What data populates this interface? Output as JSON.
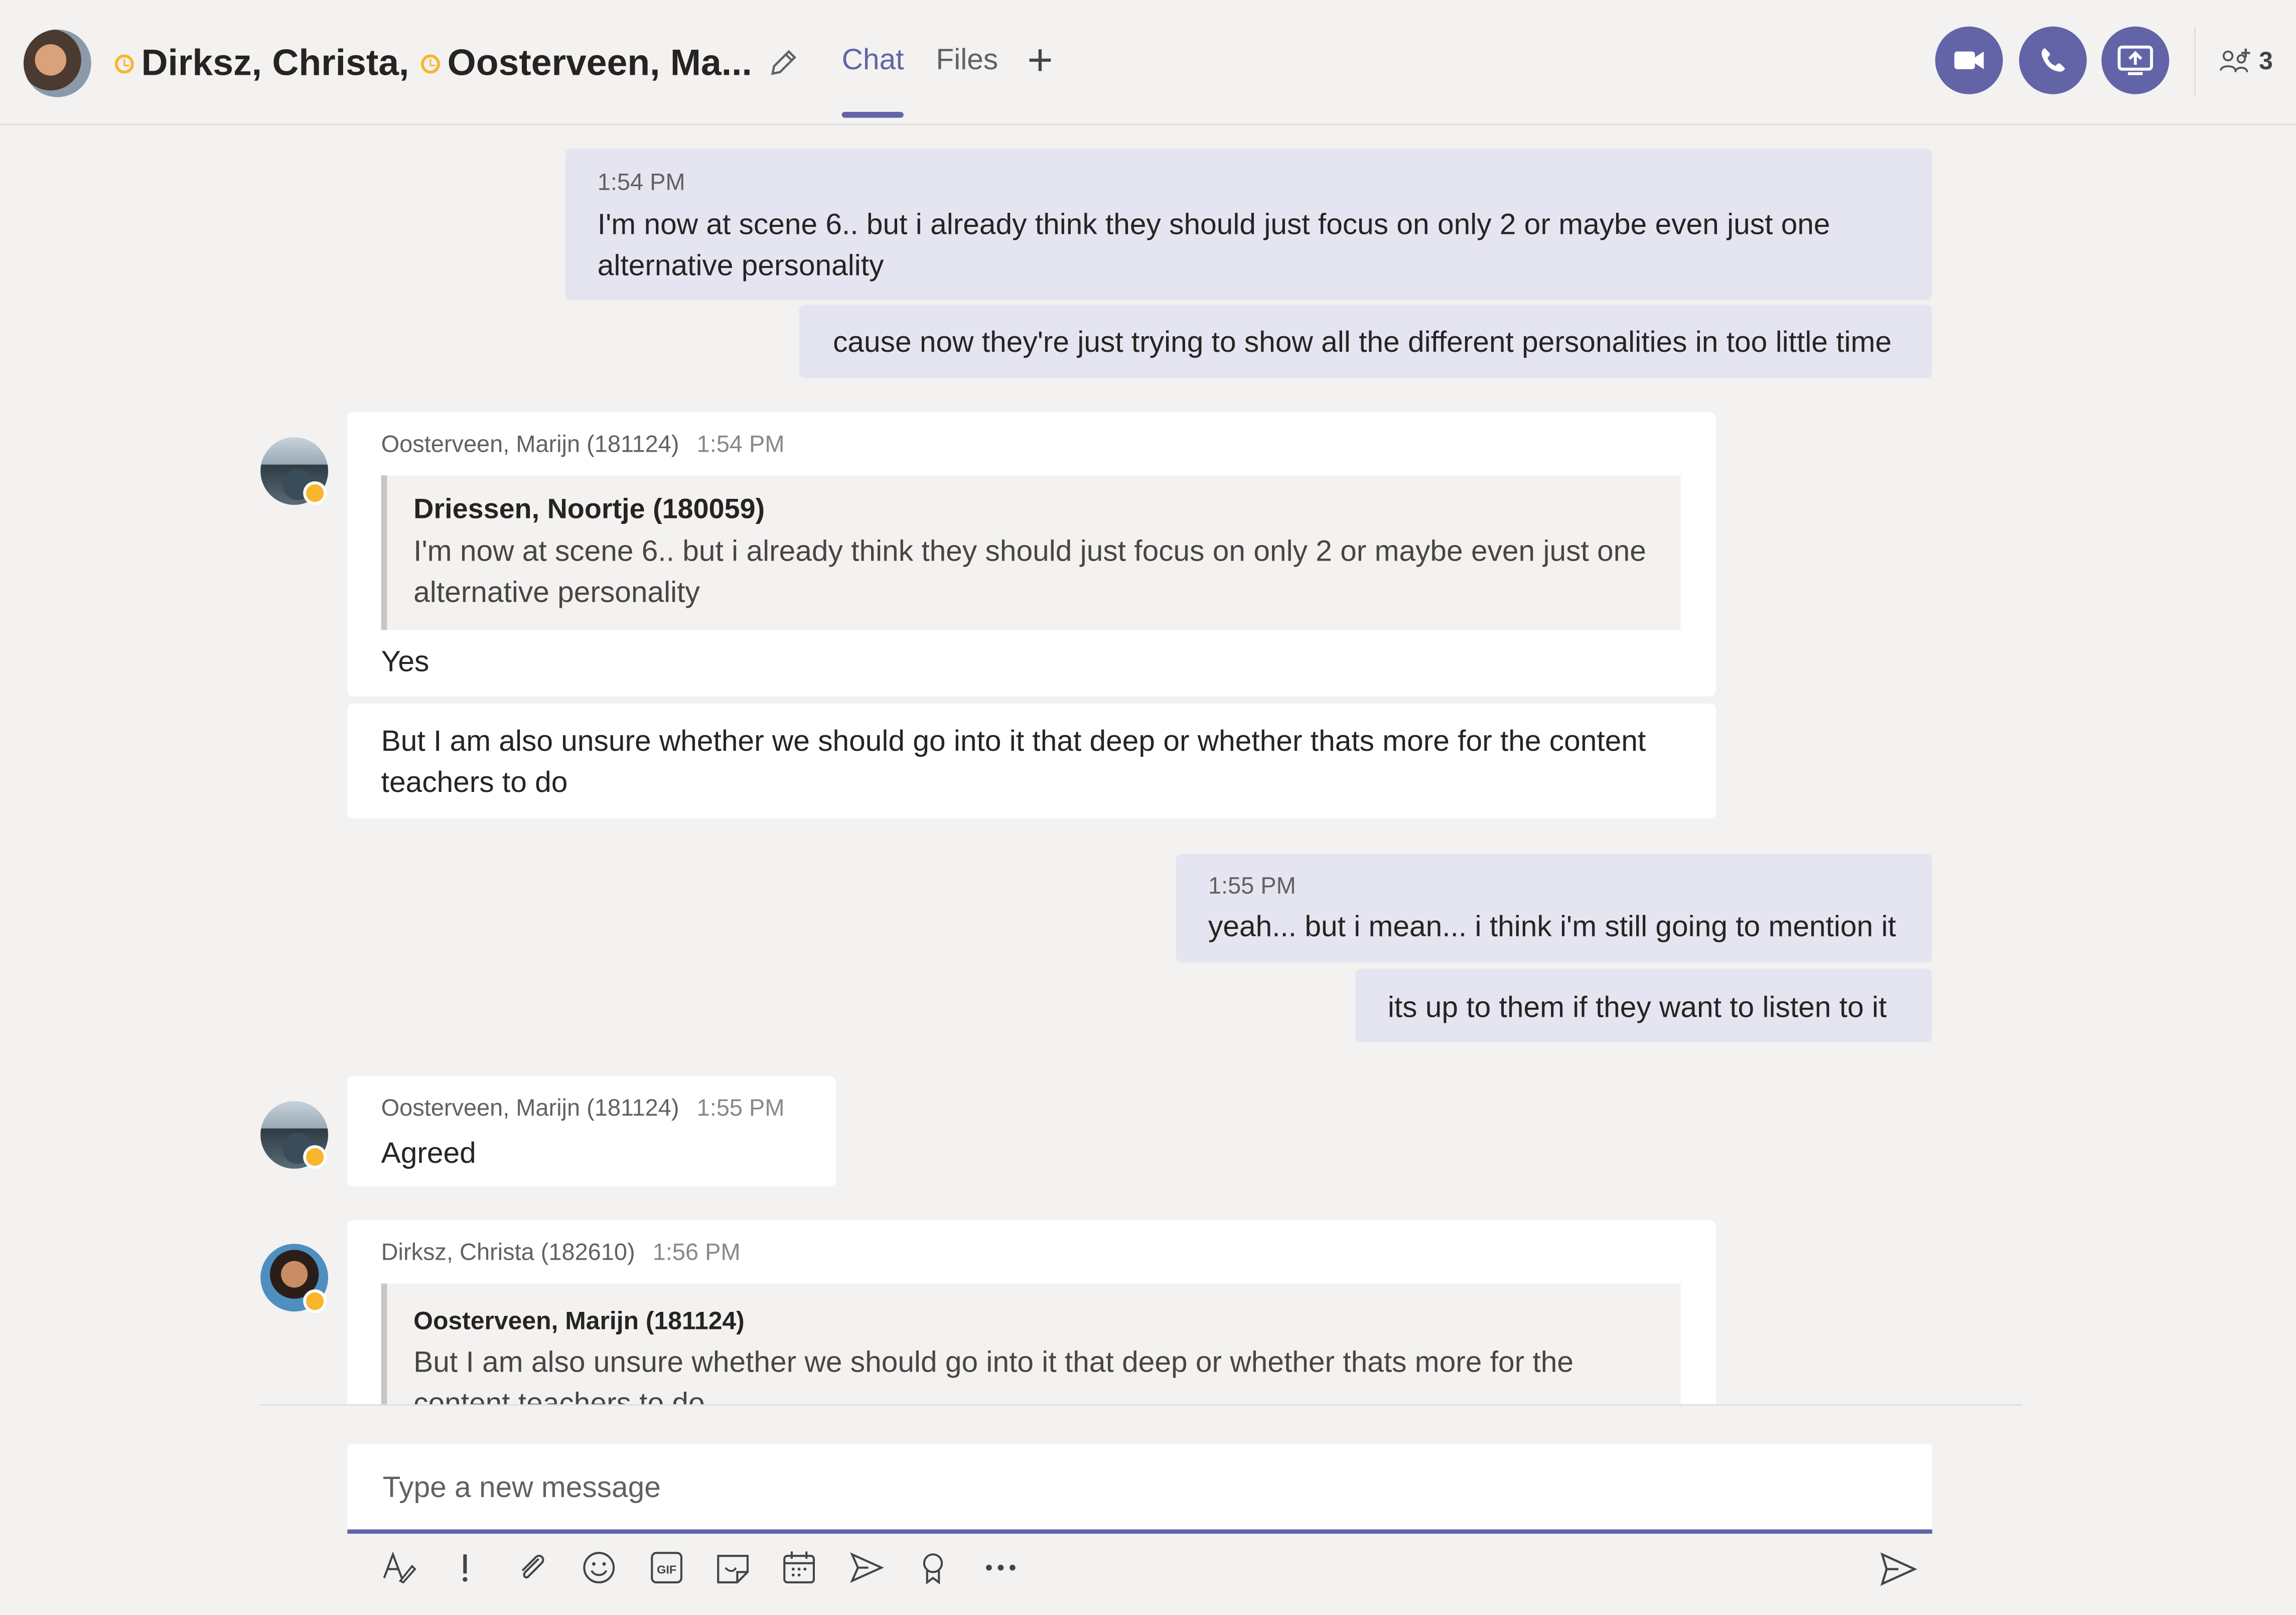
{
  "header": {
    "participant_1": "Dirksz, Christa,",
    "participant_2": "Oosterveen, Ma...",
    "tabs": [
      {
        "label": "Chat"
      },
      {
        "label": "Files"
      }
    ],
    "add_tab": "+",
    "participant_count": "3"
  },
  "messages": [
    {
      "time": "1:54 PM",
      "text": "I'm now at scene 6.. but i already think they should just focus on only 2 or maybe even just one alternative personality"
    },
    {
      "text": "cause now they're just trying to show all the different personalities in too little time"
    },
    {
      "author": "Oosterveen, Marijn (181124)",
      "time": "1:54 PM",
      "quote_author": "Driessen, Noortje (180059)",
      "quote_text": "I'm now at scene 6.. but i already think they should just focus on only 2 or maybe even just one alternative personality",
      "text": "Yes"
    },
    {
      "text": "But I am also unsure whether we should go into it that deep or whether thats more for the content teachers to do"
    },
    {
      "time": "1:55 PM",
      "text": "yeah... but i mean... i think i'm still going to mention it"
    },
    {
      "text": "its up to them if they want to listen to it"
    },
    {
      "author": "Oosterveen, Marijn (181124)",
      "time": "1:55 PM",
      "text": "Agreed"
    },
    {
      "author": "Dirksz, Christa (182610)",
      "time": "1:56 PM",
      "quote_author": "Oosterveen, Marijn (181124)",
      "quote_text": "But I am also unsure whether we should go into it that deep or whether thats more for the content teachers to do"
    }
  ],
  "compose": {
    "placeholder": "Type a new message"
  },
  "toolbar": {
    "icons": [
      "format-icon",
      "important-icon",
      "attach-icon",
      "emoji-icon",
      "gif-icon",
      "sticker-icon",
      "meeting-icon",
      "stream-icon",
      "praise-icon",
      "more-icon",
      "send-icon"
    ]
  },
  "colors": {
    "accent": "#6264a7",
    "own_message_bg": "#e5e5f1",
    "other_message_bg": "#ffffff",
    "background": "#f3f2f1",
    "away_status": "#f8b62d"
  }
}
